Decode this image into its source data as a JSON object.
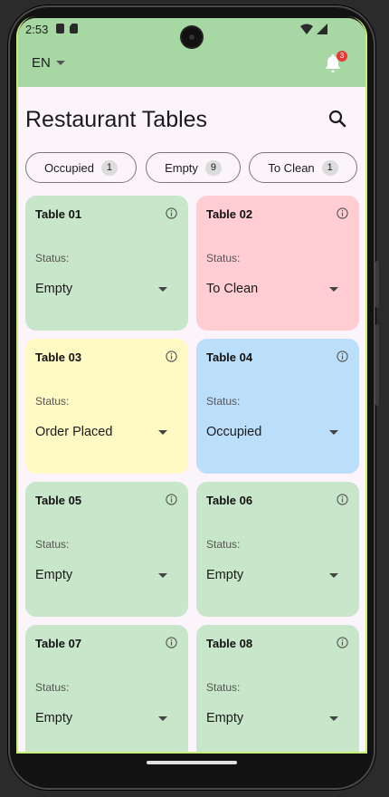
{
  "status_bar": {
    "time": "2:53"
  },
  "app_bar": {
    "language": "EN",
    "notification_count": "3"
  },
  "page": {
    "title": "Restaurant Tables"
  },
  "filters": [
    {
      "label": "Occupied",
      "count": "1"
    },
    {
      "label": "Empty",
      "count": "9"
    },
    {
      "label": "To Clean",
      "count": "1"
    }
  ],
  "status_label": "Status:",
  "tables": [
    {
      "name": "Table 01",
      "status": "Empty",
      "color": "#c8e6c9"
    },
    {
      "name": "Table 02",
      "status": "To Clean",
      "color": "#ffcdd2"
    },
    {
      "name": "Table 03",
      "status": "Order Placed",
      "color": "#fff9c4"
    },
    {
      "name": "Table 04",
      "status": "Occupied",
      "color": "#bbdefb"
    },
    {
      "name": "Table 05",
      "status": "Empty",
      "color": "#c8e6c9"
    },
    {
      "name": "Table 06",
      "status": "Empty",
      "color": "#c8e6c9"
    },
    {
      "name": "Table 07",
      "status": "Empty",
      "color": "#c8e6c9"
    },
    {
      "name": "Table 08",
      "status": "Empty",
      "color": "#c8e6c9"
    }
  ],
  "colors": {
    "app_bar": "#a7d8a4",
    "background": "#fbf5fb",
    "badge": "#e53935"
  },
  "icons": {
    "language_dropdown": "caret-down-icon",
    "notifications": "bell-icon",
    "search": "search-icon",
    "table_info": "info-icon",
    "status_dropdown": "caret-down-icon"
  }
}
